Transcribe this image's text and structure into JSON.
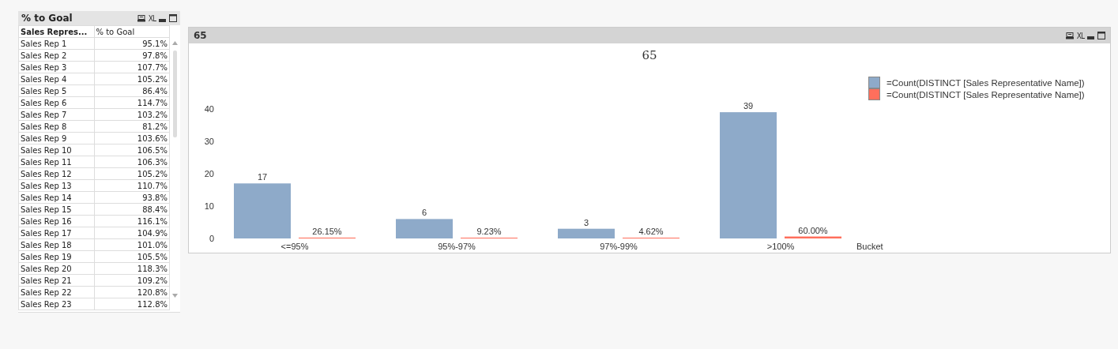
{
  "table_box": {
    "title": "% to Goal",
    "export_label": "XL",
    "columns": [
      "Sales Repres...",
      "% to Goal"
    ],
    "rows": [
      [
        "Sales Rep 1",
        "95.1%"
      ],
      [
        "Sales Rep 2",
        "97.8%"
      ],
      [
        "Sales Rep 3",
        "107.7%"
      ],
      [
        "Sales Rep 4",
        "105.2%"
      ],
      [
        "Sales Rep 5",
        "86.4%"
      ],
      [
        "Sales Rep 6",
        "114.7%"
      ],
      [
        "Sales Rep 7",
        "103.2%"
      ],
      [
        "Sales Rep 8",
        "81.2%"
      ],
      [
        "Sales Rep 9",
        "103.6%"
      ],
      [
        "Sales Rep 10",
        "106.5%"
      ],
      [
        "Sales Rep 11",
        "106.3%"
      ],
      [
        "Sales Rep 12",
        "105.2%"
      ],
      [
        "Sales Rep 13",
        "110.7%"
      ],
      [
        "Sales Rep 14",
        "93.8%"
      ],
      [
        "Sales Rep 15",
        "88.4%"
      ],
      [
        "Sales Rep 16",
        "116.1%"
      ],
      [
        "Sales Rep 17",
        "104.9%"
      ],
      [
        "Sales Rep 18",
        "101.0%"
      ],
      [
        "Sales Rep 19",
        "105.5%"
      ],
      [
        "Sales Rep 20",
        "118.3%"
      ],
      [
        "Sales Rep 21",
        "109.2%"
      ],
      [
        "Sales Rep 22",
        "120.8%"
      ],
      [
        "Sales Rep 23",
        "112.8%"
      ]
    ]
  },
  "chart_box": {
    "title": "65",
    "export_label": "XL",
    "chart_data": {
      "type": "bar",
      "title": "65",
      "xlabel": "Bucket",
      "categories": [
        "<=95%",
        "95%-97%",
        "97%-99%",
        ">100%"
      ],
      "ylim": [
        0,
        40
      ],
      "yticks": [
        0,
        10,
        20,
        30,
        40
      ],
      "series": [
        {
          "name": "=Count(DISTINCT [Sales Representative Name])",
          "color": "#8eaac9",
          "values": [
            17,
            6,
            3,
            39
          ],
          "value_labels": [
            "17",
            "6",
            "3",
            "39"
          ]
        },
        {
          "name": "=Count(DISTINCT [Sales Representative Name])",
          "color": "#ff6f5c",
          "values": [
            0.2615,
            0.0923,
            0.0462,
            0.6
          ],
          "value_labels": [
            "26.15%",
            "9.23%",
            "4.62%",
            "60.00%"
          ]
        }
      ]
    }
  }
}
